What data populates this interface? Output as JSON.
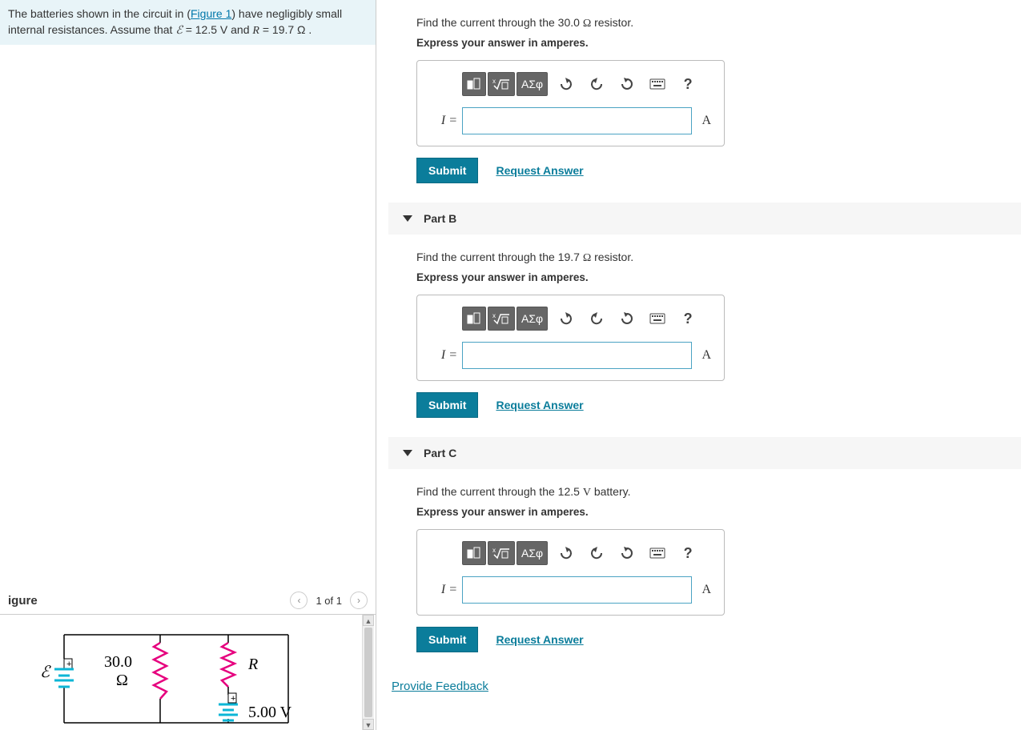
{
  "problem": {
    "text_pre": "The batteries shown in the circuit in (",
    "figure_link": "Figure 1",
    "text_mid": ") have negligibly small internal resistances. Assume that ",
    "emf_sym": "ℰ",
    "emf_val": " = 12.5 V",
    "and_text": " and ",
    "r_sym": "R",
    "r_val": " = 19.7 Ω .",
    "figure_title": "igure",
    "fig_nav": "1 of 1"
  },
  "circuit": {
    "r1_label": "30.0",
    "r1_unit": "Ω",
    "r2_label": "R",
    "emf_label": "ℰ",
    "v2_label": "5.00 V"
  },
  "parts": [
    {
      "label": "",
      "prompt_pre": "Find the current through the 30.0 ",
      "prompt_ohm": "Ω",
      "prompt_post": " resistor.",
      "instruction": "Express your answer in amperes.",
      "var_label": "I =",
      "unit": "A",
      "submit": "Submit",
      "request": "Request Answer"
    },
    {
      "label": "Part B",
      "prompt_pre": "Find the current through the 19.7 ",
      "prompt_ohm": "Ω",
      "prompt_post": " resistor.",
      "instruction": "Express your answer in amperes.",
      "var_label": "I =",
      "unit": "A",
      "submit": "Submit",
      "request": "Request Answer"
    },
    {
      "label": "Part C",
      "prompt_pre": "Find the current through the 12.5 ",
      "prompt_ohm": "V",
      "prompt_post": " battery.",
      "instruction": "Express your answer in amperes.",
      "var_label": "I =",
      "unit": "A",
      "submit": "Submit",
      "request": "Request Answer"
    }
  ],
  "toolbar": {
    "greek": "ΑΣφ",
    "help": "?"
  },
  "feedback": "Provide Feedback"
}
